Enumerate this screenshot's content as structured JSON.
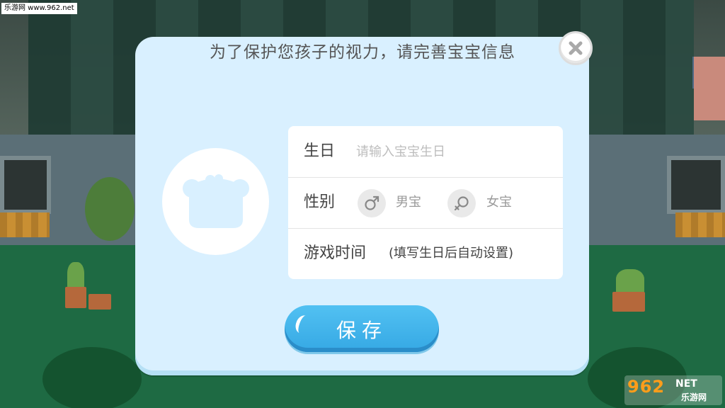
{
  "watermark": {
    "top_left": "乐游网 www.962.net",
    "logo": "962",
    "logo_suffix": "NET",
    "logo_sub": "乐游网"
  },
  "dialog": {
    "title": "为了保护您孩子的视力，请完善宝宝信息",
    "close_icon": "close-icon",
    "avatar_icon": "bear-icon",
    "birthday": {
      "label": "生日",
      "placeholder": "请输入宝宝生日",
      "value": ""
    },
    "gender": {
      "label": "性别",
      "male_label": "男宝",
      "female_label": "女宝",
      "male_icon": "male-symbol-icon",
      "female_icon": "female-symbol-icon"
    },
    "playtime": {
      "label": "游戏时间",
      "note": "(填写生日后自动设置)"
    },
    "save_label": "保存"
  },
  "colors": {
    "dialog_bg": "#d9f0ff",
    "save_button": "#3daaed",
    "text": "#444444"
  }
}
